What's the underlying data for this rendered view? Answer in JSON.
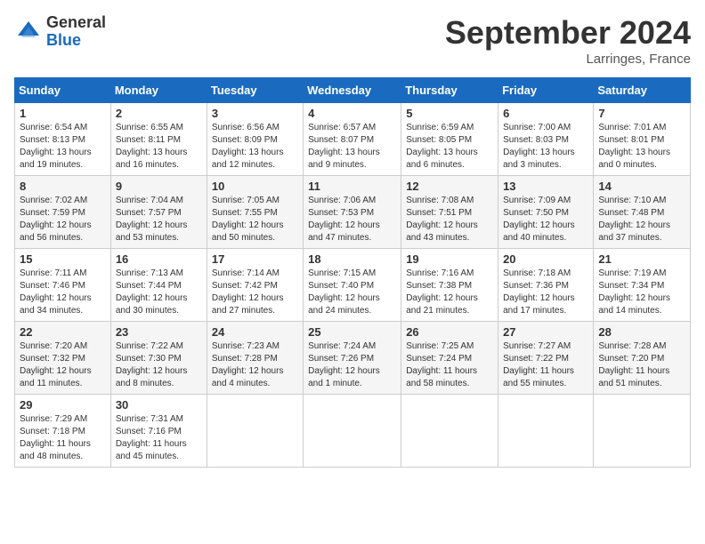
{
  "header": {
    "logo_general": "General",
    "logo_blue": "Blue",
    "month_title": "September 2024",
    "location": "Larringes, France"
  },
  "days_of_week": [
    "Sunday",
    "Monday",
    "Tuesday",
    "Wednesday",
    "Thursday",
    "Friday",
    "Saturday"
  ],
  "weeks": [
    [
      {
        "day": "1",
        "info": "Sunrise: 6:54 AM\nSunset: 8:13 PM\nDaylight: 13 hours\nand 19 minutes."
      },
      {
        "day": "2",
        "info": "Sunrise: 6:55 AM\nSunset: 8:11 PM\nDaylight: 13 hours\nand 16 minutes."
      },
      {
        "day": "3",
        "info": "Sunrise: 6:56 AM\nSunset: 8:09 PM\nDaylight: 13 hours\nand 12 minutes."
      },
      {
        "day": "4",
        "info": "Sunrise: 6:57 AM\nSunset: 8:07 PM\nDaylight: 13 hours\nand 9 minutes."
      },
      {
        "day": "5",
        "info": "Sunrise: 6:59 AM\nSunset: 8:05 PM\nDaylight: 13 hours\nand 6 minutes."
      },
      {
        "day": "6",
        "info": "Sunrise: 7:00 AM\nSunset: 8:03 PM\nDaylight: 13 hours\nand 3 minutes."
      },
      {
        "day": "7",
        "info": "Sunrise: 7:01 AM\nSunset: 8:01 PM\nDaylight: 13 hours\nand 0 minutes."
      }
    ],
    [
      {
        "day": "8",
        "info": "Sunrise: 7:02 AM\nSunset: 7:59 PM\nDaylight: 12 hours\nand 56 minutes."
      },
      {
        "day": "9",
        "info": "Sunrise: 7:04 AM\nSunset: 7:57 PM\nDaylight: 12 hours\nand 53 minutes."
      },
      {
        "day": "10",
        "info": "Sunrise: 7:05 AM\nSunset: 7:55 PM\nDaylight: 12 hours\nand 50 minutes."
      },
      {
        "day": "11",
        "info": "Sunrise: 7:06 AM\nSunset: 7:53 PM\nDaylight: 12 hours\nand 47 minutes."
      },
      {
        "day": "12",
        "info": "Sunrise: 7:08 AM\nSunset: 7:51 PM\nDaylight: 12 hours\nand 43 minutes."
      },
      {
        "day": "13",
        "info": "Sunrise: 7:09 AM\nSunset: 7:50 PM\nDaylight: 12 hours\nand 40 minutes."
      },
      {
        "day": "14",
        "info": "Sunrise: 7:10 AM\nSunset: 7:48 PM\nDaylight: 12 hours\nand 37 minutes."
      }
    ],
    [
      {
        "day": "15",
        "info": "Sunrise: 7:11 AM\nSunset: 7:46 PM\nDaylight: 12 hours\nand 34 minutes."
      },
      {
        "day": "16",
        "info": "Sunrise: 7:13 AM\nSunset: 7:44 PM\nDaylight: 12 hours\nand 30 minutes."
      },
      {
        "day": "17",
        "info": "Sunrise: 7:14 AM\nSunset: 7:42 PM\nDaylight: 12 hours\nand 27 minutes."
      },
      {
        "day": "18",
        "info": "Sunrise: 7:15 AM\nSunset: 7:40 PM\nDaylight: 12 hours\nand 24 minutes."
      },
      {
        "day": "19",
        "info": "Sunrise: 7:16 AM\nSunset: 7:38 PM\nDaylight: 12 hours\nand 21 minutes."
      },
      {
        "day": "20",
        "info": "Sunrise: 7:18 AM\nSunset: 7:36 PM\nDaylight: 12 hours\nand 17 minutes."
      },
      {
        "day": "21",
        "info": "Sunrise: 7:19 AM\nSunset: 7:34 PM\nDaylight: 12 hours\nand 14 minutes."
      }
    ],
    [
      {
        "day": "22",
        "info": "Sunrise: 7:20 AM\nSunset: 7:32 PM\nDaylight: 12 hours\nand 11 minutes."
      },
      {
        "day": "23",
        "info": "Sunrise: 7:22 AM\nSunset: 7:30 PM\nDaylight: 12 hours\nand 8 minutes."
      },
      {
        "day": "24",
        "info": "Sunrise: 7:23 AM\nSunset: 7:28 PM\nDaylight: 12 hours\nand 4 minutes."
      },
      {
        "day": "25",
        "info": "Sunrise: 7:24 AM\nSunset: 7:26 PM\nDaylight: 12 hours\nand 1 minute."
      },
      {
        "day": "26",
        "info": "Sunrise: 7:25 AM\nSunset: 7:24 PM\nDaylight: 11 hours\nand 58 minutes."
      },
      {
        "day": "27",
        "info": "Sunrise: 7:27 AM\nSunset: 7:22 PM\nDaylight: 11 hours\nand 55 minutes."
      },
      {
        "day": "28",
        "info": "Sunrise: 7:28 AM\nSunset: 7:20 PM\nDaylight: 11 hours\nand 51 minutes."
      }
    ],
    [
      {
        "day": "29",
        "info": "Sunrise: 7:29 AM\nSunset: 7:18 PM\nDaylight: 11 hours\nand 48 minutes."
      },
      {
        "day": "30",
        "info": "Sunrise: 7:31 AM\nSunset: 7:16 PM\nDaylight: 11 hours\nand 45 minutes."
      },
      {
        "day": "",
        "info": ""
      },
      {
        "day": "",
        "info": ""
      },
      {
        "day": "",
        "info": ""
      },
      {
        "day": "",
        "info": ""
      },
      {
        "day": "",
        "info": ""
      }
    ]
  ]
}
